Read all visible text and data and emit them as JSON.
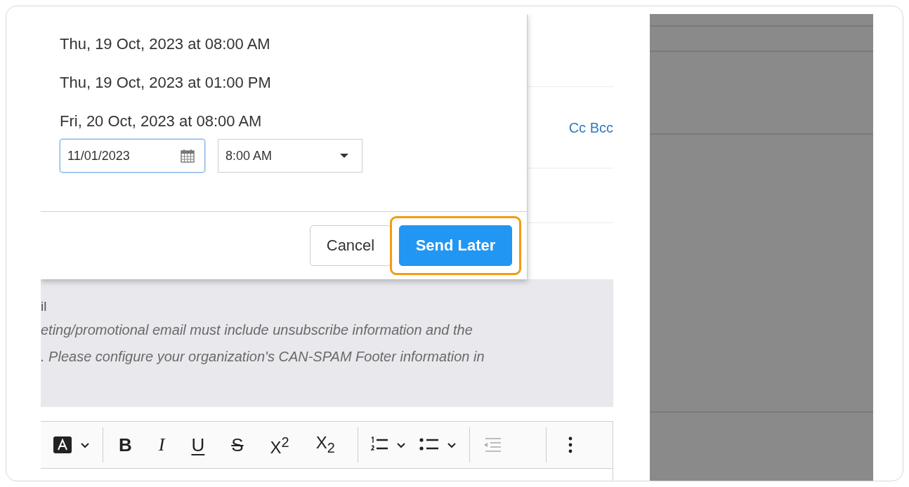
{
  "schedule_popup": {
    "options": [
      "Thu, 19 Oct, 2023 at 08:00 AM",
      "Thu, 19 Oct, 2023 at 01:00 PM",
      "Fri, 20 Oct, 2023 at 08:00 AM"
    ],
    "date_field": {
      "value": "11/01/2023",
      "focused": true
    },
    "time_select": {
      "value": "8:00 AM"
    },
    "buttons": [
      {
        "label": "Cancel",
        "kind": "secondary",
        "highlighted": false
      },
      {
        "label": "Send Later",
        "kind": "primary",
        "highlighted": true
      }
    ]
  },
  "cc_bcc_link": "Cc Bcc",
  "notice": {
    "title": "il",
    "lines": [
      "eting/promotional email must include unsubscribe information and the",
      ". Please configure your organization's CAN-SPAM Footer information in"
    ]
  },
  "toolbar": [
    {
      "kind": "text-color"
    },
    {
      "kind": "chevron"
    },
    {
      "kind": "separator"
    },
    {
      "kind": "bold",
      "label": "B"
    },
    {
      "kind": "italic",
      "label": "I"
    },
    {
      "kind": "underline",
      "label": "U"
    },
    {
      "kind": "strike",
      "label": "S"
    },
    {
      "kind": "script",
      "label": "X$^{2}$"
    },
    {
      "kind": "script",
      "label": "X$_{2}$"
    },
    {
      "kind": "separator"
    },
    {
      "kind": "ordered-list"
    },
    {
      "kind": "chevron"
    },
    {
      "kind": "bullet-list"
    },
    {
      "kind": "chevron"
    },
    {
      "kind": "separator"
    },
    {
      "kind": "outdent"
    },
    {
      "kind": "spacer"
    },
    {
      "kind": "separator"
    },
    {
      "kind": "more"
    }
  ]
}
